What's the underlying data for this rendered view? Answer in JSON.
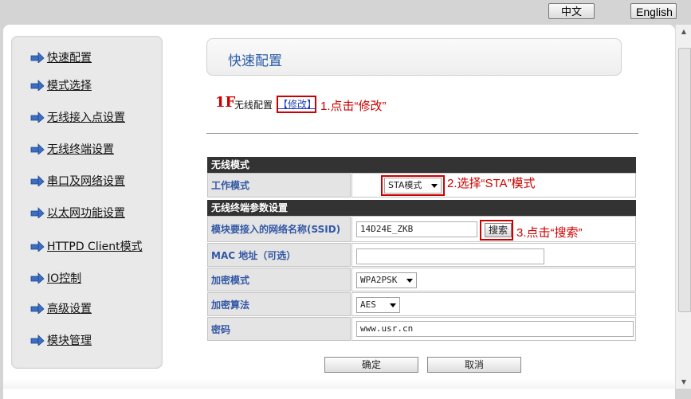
{
  "header": {
    "lang_zh": "中文",
    "lang_en": "English"
  },
  "sidebar": {
    "items": [
      {
        "label": "快速配置"
      },
      {
        "label": "模式选择"
      },
      {
        "label": "无线接入点设置"
      },
      {
        "label": "无线终端设置"
      },
      {
        "label": "串口及网络设置"
      },
      {
        "label": "以太网功能设置"
      },
      {
        "label": "HTTPD Client模式"
      },
      {
        "label": "IO控制"
      },
      {
        "label": "高级设置"
      },
      {
        "label": "模块管理"
      }
    ]
  },
  "main": {
    "title": "快速配置",
    "step1": {
      "prefix": "1F",
      "label": "无线配置",
      "modify_link": "【修改】",
      "annotation": "1.点击“修改”"
    },
    "sections": {
      "wireless_mode": {
        "header": "无线模式",
        "work_mode_label": "工作模式",
        "work_mode_value": "STA模式",
        "annotation": "2.选择“STA”模式"
      },
      "sta_params": {
        "header": "无线终端参数设置",
        "ssid_label": "模块要接入的网络名称(SSID)",
        "ssid_value": "14D24E_ZKB",
        "search_button": "搜索",
        "search_annotation": "3.点击“搜索”",
        "mac_label": "MAC 地址（可选）",
        "mac_value": "",
        "encryption_mode_label": "加密模式",
        "encryption_mode_value": "WPA2PSK",
        "encryption_algo_label": "加密算法",
        "encryption_algo_value": "AES",
        "password_label": "密码",
        "password_value": "www.usr.cn"
      }
    },
    "buttons": {
      "confirm": "确定",
      "cancel": "取消"
    }
  },
  "colors": {
    "accent": "#2a5ca8",
    "annotation": "#cc0000",
    "header_bar": "#333333"
  }
}
